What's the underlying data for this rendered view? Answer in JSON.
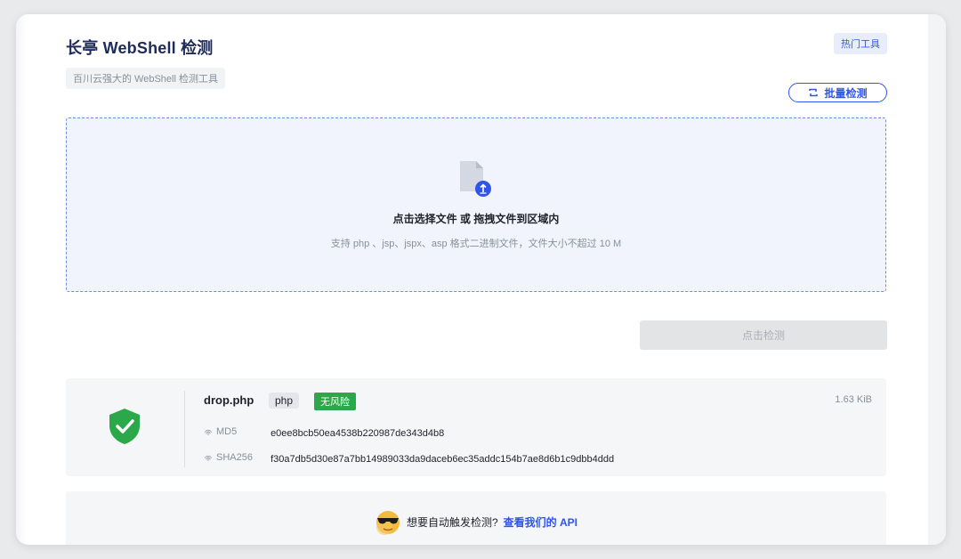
{
  "header": {
    "title": "长亭 WebShell 检测",
    "subtitle": "百川云强大的 WebShell 检测工具",
    "hot_tag": "热门工具"
  },
  "toolbar": {
    "batch_label": "批量检测"
  },
  "dropzone": {
    "main_text": "点击选择文件 或 拖拽文件到区域内",
    "hint_text": "支持 php 、jsp、jspx、asp 格式二进制文件，文件大小不超过 10 M",
    "icon": "file-upload-icon"
  },
  "detect_button": {
    "label": "点击检测",
    "state": "disabled"
  },
  "result": {
    "file_name": "drop.php",
    "ext": "php",
    "risk": "无风险",
    "size": "1.63 KiB",
    "md5_label": "MD5",
    "md5": "e0ee8bcb50ea4538b220987de343d4b8",
    "sha256_label": "SHA256",
    "sha256": "f30a7db5d30e87a7bb14989033da9daceb6ec35addc154b7ae8d6b1c9dbb4ddd",
    "status_icon": "shield-check-icon"
  },
  "api_banner": {
    "text": "想要自动触发检测?",
    "link": "查看我们的 API"
  },
  "colors": {
    "accent": "#2f54eb",
    "safe": "#2ba84a",
    "title": "#1d2b5a"
  }
}
